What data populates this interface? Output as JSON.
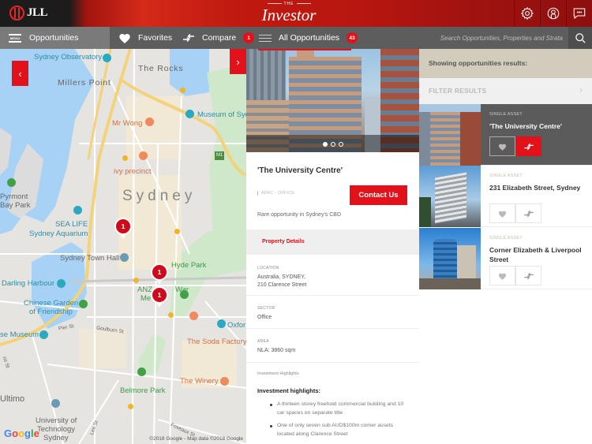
{
  "header": {
    "logo_text": "JLL",
    "brand_small": "THE",
    "brand_name": "Investor",
    "icons": [
      "gear-icon",
      "user-icon",
      "chat-icon"
    ]
  },
  "nav": {
    "opportunities_label": "Opportunities",
    "menu_label": "MENU",
    "favorites_label": "Favorites",
    "compare_label": "Compare",
    "compare_count": "1",
    "all_opps_label": "All Opportunities",
    "all_opps_count": "43",
    "search_placeholder": "Search Opportunities, Properties and Strata"
  },
  "map": {
    "labels": {
      "sydney_observatory": "Sydney Observatory",
      "the_rocks": "The Rocks",
      "millers_point": "Millers Point",
      "mr_wong": "Mr Wong",
      "museum_of_sydney": "Museum of Syd",
      "m1": "M1",
      "ivy_precinct": "ivy precinct",
      "sydney": "Sydney",
      "pyrmont": "Pyrmont",
      "bay_park": "Bay Park",
      "sea_life": "SEA LIFE",
      "sydney_aquarium": "Sydney Aquarium",
      "town_hall": "Sydney Town Hall",
      "hyde_park": "Hyde Park",
      "darling_harbour": "Darling Harbour",
      "chinese_garden": "Chinese Garden",
      "of_friendship": "of Friendship",
      "anz": "ANZ",
      "war": "War",
      "memorial_me": "Me",
      "memorial_l": "l",
      "pier_st": "Pier St",
      "goulburn_st": "Goulburn St",
      "museum": "se Museum",
      "oxford": "Oxfor",
      "soda_factory": "The Soda Factory",
      "winery": "The Winery",
      "belmore_park": "Belmore Park",
      "ultimo": "Ultimo",
      "uts1": "University of",
      "uts2": "Technology",
      "uts3": "Sydney",
      "lee_st": "Lee St",
      "foveaux_st": "Foveaux St",
      "harris_st": "ris St"
    },
    "pins": [
      {
        "count": "1"
      },
      {
        "count": "1"
      },
      {
        "count": "1"
      }
    ],
    "google_letters": [
      "G",
      "o",
      "o",
      "g",
      "l",
      "e"
    ],
    "copyright": "©2018 Google - Map data ©2018 Google",
    "prev_label": "‹",
    "next_label": "›"
  },
  "detail": {
    "title": "'The University Centre'",
    "tag": "APAC - OFFICE",
    "contact_label": "Contact Us",
    "description": "Rare opportunity in Sydney's CBD",
    "tab_label": "Property Details",
    "carousel": {
      "total": 3,
      "active": 1
    },
    "fields": [
      {
        "label": "LOCATION",
        "value_line1": "Australia, SYDNEY,",
        "value_line2": "210 Clarence Street"
      },
      {
        "label": "SECTOR",
        "value_line1": "Office"
      },
      {
        "label": "AREA",
        "value_line1": "NLA: 3860 sqm"
      }
    ],
    "highlights_heading": "Investment Highlights",
    "highlights_title": "Investment highlights:",
    "highlights": [
      "A thirteen storey freehold commercial building and 10 car spaces on separate title",
      "One of only seven sub AUD$100m corner assets located along Clarence Street"
    ]
  },
  "results": {
    "heading": "Showing opportunities results:",
    "filter_label": "FILTER RESULTS",
    "items": [
      {
        "type": "SINGLE ASSET",
        "name": "'The University Centre'",
        "active": true
      },
      {
        "type": "SINGLE ASSET",
        "name": "231 Elizabeth Street, Sydney",
        "active": false
      },
      {
        "type": "SINGLE ASSET",
        "name": "Corner Elizabeth & Liverpool Street",
        "active": false
      }
    ]
  },
  "colors": {
    "accent": "#e2111a",
    "nav_bg": "#5d5d5d",
    "results_head_bg": "#d2ccbd"
  }
}
